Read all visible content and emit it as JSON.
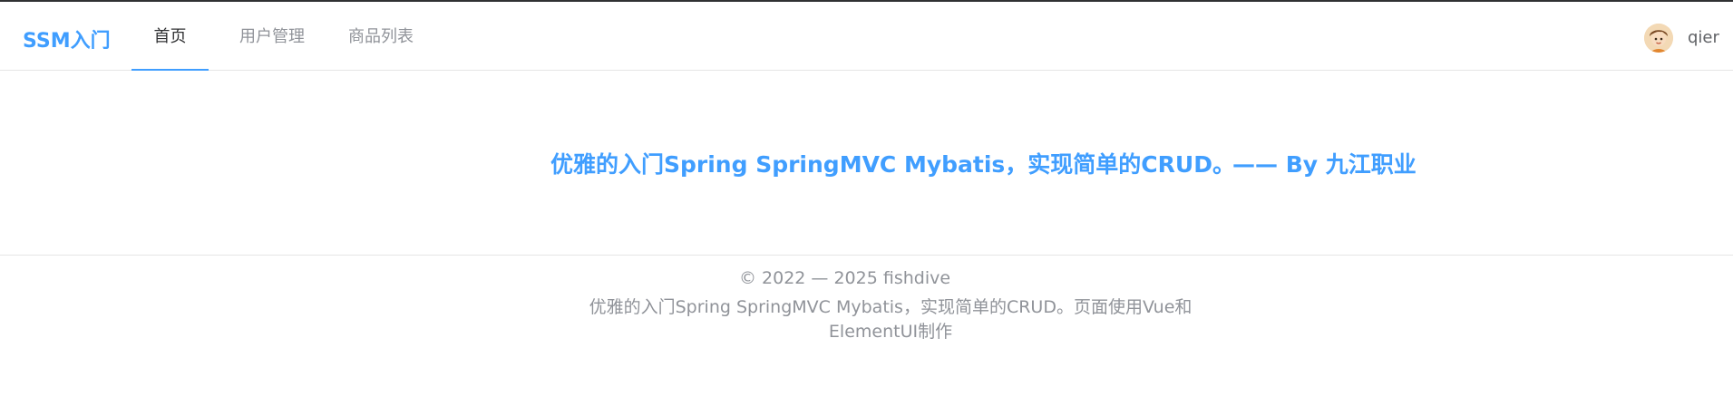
{
  "navbar": {
    "brand": "SSM入门",
    "items": [
      {
        "label": "首页",
        "active": true
      },
      {
        "label": "用户管理",
        "active": false
      },
      {
        "label": "商品列表",
        "active": false
      }
    ],
    "user": {
      "name": "qier",
      "avatar_icon": "user-avatar-icon"
    }
  },
  "hero": {
    "tagline": "优雅的入门Spring SpringMVC Mybatis，实现简单的CRUD。",
    "author": "—— By 九江职业"
  },
  "footer": {
    "copyright": "© 2022 — 2025 fishdive",
    "description": "优雅的入门Spring SpringMVC Mybatis，实现简单的CRUD。页面使用Vue和ElementUI制作"
  },
  "colors": {
    "accent": "#409eff",
    "text_primary": "#303133",
    "text_secondary": "#909399",
    "border": "#e6e6e6"
  }
}
